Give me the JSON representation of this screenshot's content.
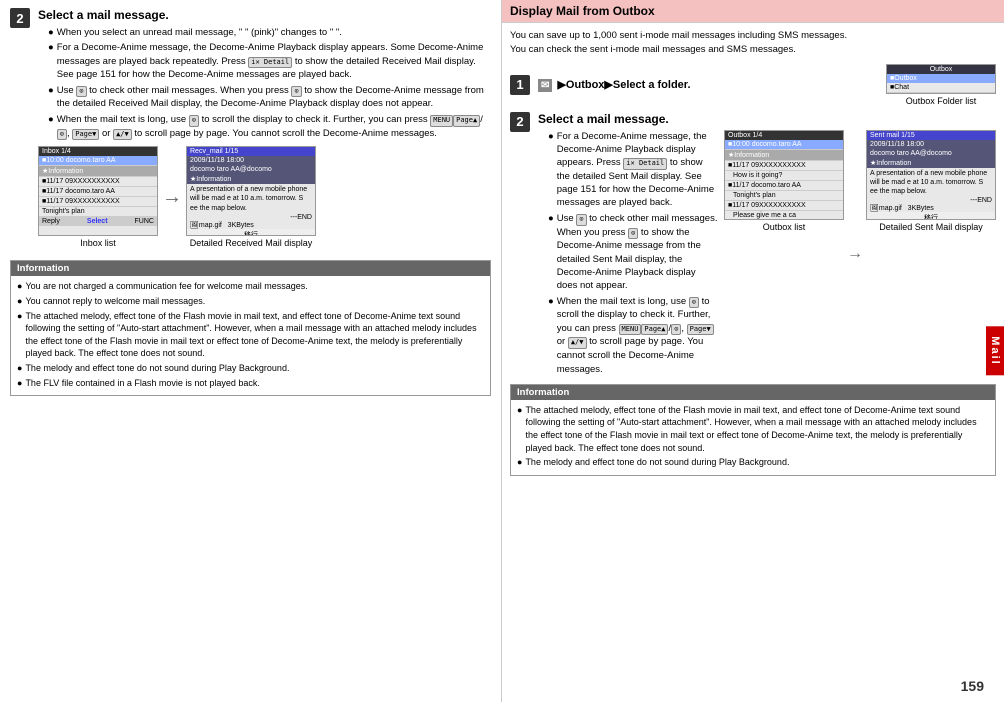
{
  "page_number": "159",
  "left": {
    "step2_title": "Select a mail message.",
    "step2_bullets": [
      "When you select an unread mail message, \" \" (pink)\" changes to \" \".",
      "For a Decome-Anime message, the Decome-Anime Playback display appears. Some Decome-Anime messages are played back repeatedly. Press  ( ) to show the detailed Received Mail display. See page 151 for how the Decome-Anime messages are played back.",
      "Use  to check other mail messages. When you press  to show the Decome-Anime message from the detailed Received Mail display, the Decome-Anime Playback display does not appear.",
      "When the mail text is long, use  to scroll the display to check it. Further, you can press  /  or  to scroll page by page. You cannot scroll the Decome-Anime messages."
    ],
    "screen1_label": "Inbox list",
    "screen2_label": "Detailed Received Mail display",
    "inbox_header": "Inbox   1/4",
    "inbox_rows": [
      "10:00 docomo.taro AA",
      "Information",
      "11/17 09XXXXXXXXX",
      "11/17 docomo.taro AA",
      "11/17 09XXXXXXXXX",
      "Tonight's plan"
    ],
    "recv_header": "Recv_mail   1/15",
    "recv_sub": "2009/11/18 18:00",
    "recv_rows": [
      "docomo taro AA@docomo",
      "Information",
      "A presentation of a new mobile phone will be mad e at 10 a.m. tomorrow. S ee the map below.",
      "---END",
      "map.gif   3KBytes",
      "移行"
    ],
    "information_header": "Information",
    "info_items": [
      "You are not charged a communication fee for welcome mail messages.",
      "You cannot reply to welcome mail messages.",
      "The attached melody, effect tone of the Flash movie in mail text, and effect tone of Decome-Anime text sound following the setting of \"Auto-start attachment\". However, when a mail message with an attached melody includes the effect tone of the Flash movie in mail text or effect tone of Decome-Anime text, the melody is preferentially played back. The effect tone does not sound.",
      "The melody and effect tone do not sound during Play Background.",
      "The FLV file contained in a Flash movie is not played back."
    ]
  },
  "right": {
    "header": "Display Mail from Outbox",
    "intro_lines": [
      "You can save up to 1,000 sent i-mode mail messages including SMS messages.",
      "You can check the sent i-mode mail messages and SMS messages."
    ],
    "step1_title": "▶Outbox▶Select a folder.",
    "step1_folder_label": "Outbox Folder list",
    "step1_folder_rows": [
      "Outbox",
      "Outbox",
      "Chat"
    ],
    "step2_title": "Select a mail message.",
    "step2_bullets": [
      "For a Decome-Anime message, the Decome-Anime Playback display appears. Press  ( ) to show the detailed Sent Mail display. See page 151 for how the Decome-Anime messages are played back.",
      "Use  to check other mail messages. When you press  to show the Decome-Anime message from the detailed Sent Mail display, the Decome-Anime Playback display does not appear.",
      "When the mail text is long, use  to scroll the display to check it. Further, you can press  /  or  to scroll page by page. You cannot scroll the Decome-Anime messages."
    ],
    "screen1_label": "Outbox list",
    "screen2_label": "Detailed Sent Mail display",
    "outbox_header": "Outbox   1/4",
    "outbox_rows": [
      "10:00 docomo.taro AA",
      "Information",
      "11/17 09XXXXXXXXX",
      "How is it going?",
      "11/17 docomo.taro AA",
      "Tonight's plan",
      "11/17 09XXXXXXXXX",
      "Please give me a ca"
    ],
    "sent_header": "Sent mail   1/15",
    "sent_sub": "2009/11/18 18:00",
    "sent_rows": [
      "docomo taro AA@docomo",
      "Information",
      "A presentation of a new mobile phone will be mad e at 10 a.m. tomorrow. S ee the map below.",
      "---END",
      "map.gif   3KBytes",
      "移行"
    ],
    "info_items": [
      "The attached melody, effect tone of the Flash movie in mail text, and effect tone of Decome-Anime text sound following the setting of \"Auto-start attachment\". However, when a mail message with an attached melody includes the effect tone of the Flash movie in mail text or effect tone of Decome-Anime text, the melody is preferentially played back. The effect tone does not sound.",
      "The melody and effect tone do not sound during Play Background."
    ],
    "information_header": "Information",
    "mail_tab_label": "Mail"
  }
}
